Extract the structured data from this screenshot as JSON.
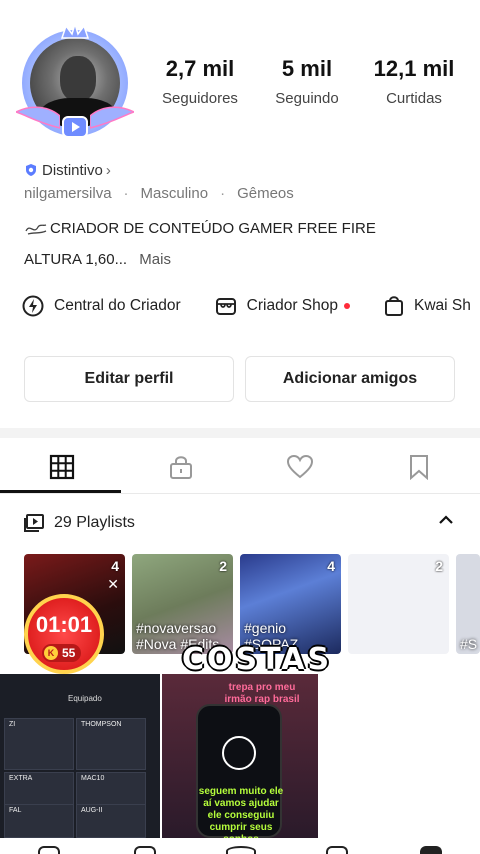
{
  "profile": {
    "stats": [
      {
        "value": "2,7 mil",
        "label": "Seguidores"
      },
      {
        "value": "5 mil",
        "label": "Seguindo"
      },
      {
        "value": "12,1 mil",
        "label": "Curtidas"
      }
    ],
    "badge": "Distintivo",
    "badge_arrow": "›",
    "username": "nilgamersilva",
    "gender": "Masculino",
    "sign": "Gêmeos",
    "separator": "·",
    "bio_line1": "CRIADOR DE CONTEÚDO GAMER FREE FIRE",
    "bio_line2": "ALTURA 1,60...",
    "more": "Mais",
    "accent": "#6f8cff"
  },
  "creator_links": [
    {
      "label": "Central do Criador",
      "icon": "lightning-circle-icon"
    },
    {
      "label": "Criador Shop",
      "icon": "shop-icon",
      "dot": "#ff2b3a"
    },
    {
      "label": "Kwai Sh",
      "icon": "bag-icon"
    }
  ],
  "buttons": {
    "edit": "Editar perfil",
    "add_friends": "Adicionar amigos"
  },
  "tabs": [
    {
      "name": "grid",
      "icon": "grid-icon",
      "active": true
    },
    {
      "name": "private",
      "icon": "lock-icon"
    },
    {
      "name": "likes",
      "icon": "heart-icon"
    },
    {
      "name": "saved",
      "icon": "bookmark-icon"
    }
  ],
  "playlists": {
    "label": "29 Playlists",
    "items": [
      {
        "count": "4",
        "caption": ""
      },
      {
        "count": "2",
        "caption": "#novaversao #Nova #Edits"
      },
      {
        "count": "4",
        "caption": "#genio #SOPAZ"
      },
      {
        "count": "2",
        "caption": ""
      },
      {
        "count": "",
        "caption": "#S"
      }
    ]
  },
  "timer": {
    "time": "01:01",
    "coins": "55"
  },
  "videos": {
    "g1_title": "Equipado",
    "g1_cells": [
      "ZI",
      "THOMPSON",
      "EXTRA",
      "MAC10",
      "FAL",
      "AUG-II"
    ],
    "g2_top": "trepa pro meu irmão rap brasil",
    "g2_bottom": "seguem muito ele aí vamos ajudar ele conseguiu cumprir seus sonhos"
  },
  "overlay": "COSTAS"
}
